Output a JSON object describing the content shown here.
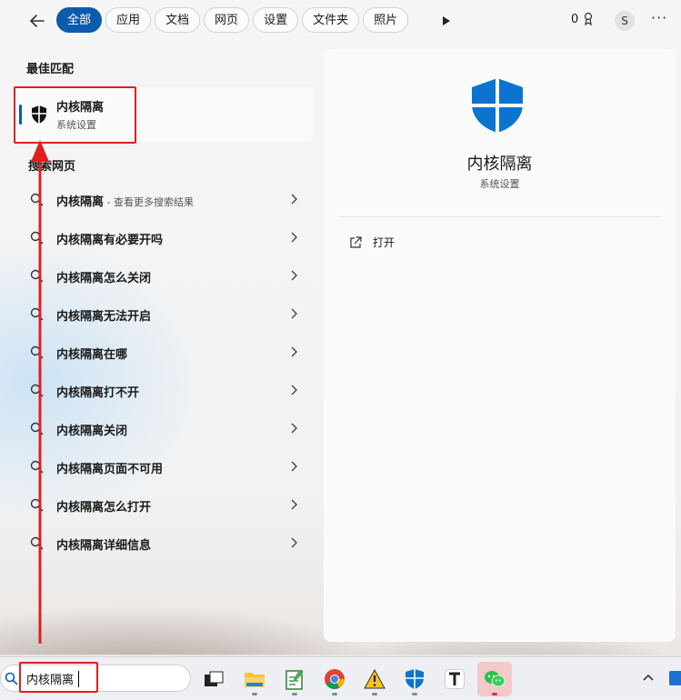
{
  "filters": {
    "chips": [
      {
        "label": "全部",
        "active": true
      },
      {
        "label": "应用",
        "active": false
      },
      {
        "label": "文档",
        "active": false
      },
      {
        "label": "网页",
        "active": false
      },
      {
        "label": "设置",
        "active": false
      },
      {
        "label": "文件夹",
        "active": false
      },
      {
        "label": "照片",
        "active": false
      }
    ],
    "points": "0",
    "avatar_initial": "S"
  },
  "best_match": {
    "heading": "最佳匹配",
    "title": "内核隔离",
    "subtitle": "系统设置",
    "icon": "shield-icon"
  },
  "web": {
    "heading": "搜索网页",
    "results": [
      {
        "text": "内核隔离",
        "hint": " - 查看更多搜索结果"
      },
      {
        "text": "内核隔离有必要开吗",
        "hint": ""
      },
      {
        "text": "内核隔离怎么关闭",
        "hint": ""
      },
      {
        "text": "内核隔离无法开启",
        "hint": ""
      },
      {
        "text": "内核隔离在哪",
        "hint": ""
      },
      {
        "text": "内核隔离打不开",
        "hint": ""
      },
      {
        "text": "内核隔离关闭",
        "hint": ""
      },
      {
        "text": "内核隔离页面不可用",
        "hint": ""
      },
      {
        "text": "内核隔离怎么打开",
        "hint": ""
      },
      {
        "text": "内核隔离详细信息",
        "hint": ""
      }
    ]
  },
  "detail": {
    "name": "内核隔离",
    "type": "系统设置",
    "open_label": "打开"
  },
  "taskbar": {
    "search_value": "内核隔离",
    "apps": [
      "task-view-icon",
      "file-explorer-icon",
      "notepad-icon",
      "chrome-icon",
      "warning-app-icon",
      "windows-security-icon",
      "typora-icon",
      "wechat-icon"
    ]
  },
  "colors": {
    "accent": "#0b5cad",
    "annotation_red": "#e21f1f",
    "shield_blue": "#0c74d0"
  }
}
